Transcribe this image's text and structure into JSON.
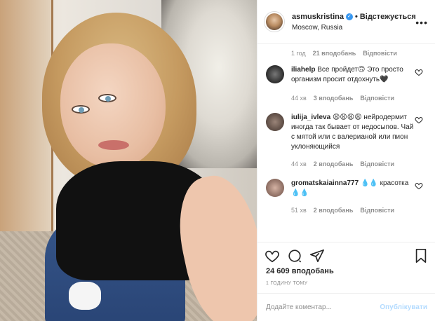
{
  "post": {
    "username": "asmuskristina",
    "follow_status": "Відстежується",
    "location": "Moscow, Russia",
    "more_label": "•••",
    "caption_meta": {
      "time": "1 год",
      "likes": "21 вподобань",
      "reply": "Відповісти"
    },
    "comments": [
      {
        "username": "iliahelp",
        "text": "Все пройдет🙃 Это просто организм просит отдохнуть🖤",
        "time": "44 хв",
        "likes": "3 вподобань",
        "reply": "Відповісти",
        "avatar_color": "#2b2b2b"
      },
      {
        "username": "iulija_ivleva",
        "text": "😩😩😩😩 нейродермит иногда так бывает от недосыпов. Чай с мятой или с валерианой или пион уклоняющийся",
        "time": "44 хв",
        "likes": "2 вподобань",
        "reply": "Відповісти",
        "avatar_color": "#6b5a50"
      },
      {
        "username": "gromatskaiainna777",
        "text": "💧💧 красотка 💧💧",
        "time": "51 хв",
        "likes": "2 вподобань",
        "reply": "Відповісти",
        "avatar_color": "#8a6b60"
      }
    ],
    "likes_count": "24 609 вподобань",
    "posted_ago": "1 ГОДИНУ ТОМУ",
    "comment_placeholder": "Додайте коментар...",
    "publish_label": "Опублікувати"
  },
  "colors": {
    "link_blue": "#3897f0",
    "publish_disabled": "#b3dbff",
    "secondary_text": "#8e8e8e"
  },
  "icons": [
    "verified-icon",
    "heart-icon",
    "comment-icon",
    "share-icon",
    "bookmark-icon",
    "more-icon"
  ]
}
